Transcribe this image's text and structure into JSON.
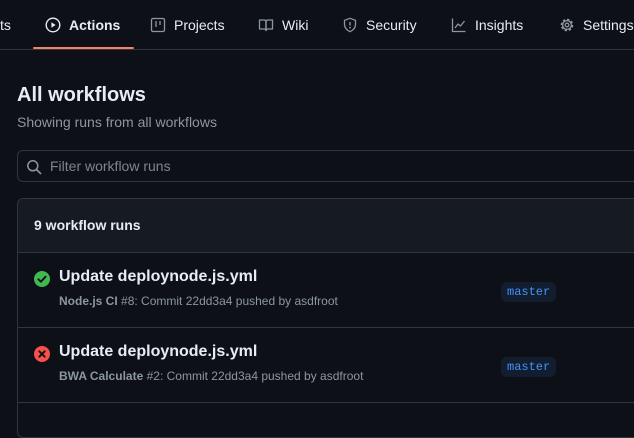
{
  "tabs": [
    {
      "label": "ts",
      "icon": "none"
    },
    {
      "label": "Actions",
      "icon": "play-icon",
      "active": true
    },
    {
      "label": "Projects",
      "icon": "table-icon"
    },
    {
      "label": "Wiki",
      "icon": "book-icon"
    },
    {
      "label": "Security",
      "icon": "shield-icon"
    },
    {
      "label": "Insights",
      "icon": "graph-icon"
    },
    {
      "label": "Settings",
      "icon": "gear-icon"
    }
  ],
  "page": {
    "title": "All workflows",
    "subtitle": "Showing runs from all workflows"
  },
  "search": {
    "placeholder": "Filter workflow runs"
  },
  "runs": {
    "count_label": "9 workflow runs",
    "items": [
      {
        "status": "success",
        "title": "Update deploynode.js.yml",
        "workflow": "Node.js CI",
        "run_number": "#8",
        "detail": ": Commit 22dd3a4 pushed by asdfroot",
        "branch": "master"
      },
      {
        "status": "failure",
        "title": "Update deploynode.js.yml",
        "workflow": "BWA Calculate",
        "run_number": "#2",
        "detail": ": Commit 22dd3a4 pushed by asdfroot",
        "branch": "master"
      }
    ]
  },
  "colors": {
    "background": "#0d1117",
    "accent_underline": "#f78166",
    "success": "#3fb950",
    "failure": "#f85149",
    "branch_text": "#4493f8"
  }
}
